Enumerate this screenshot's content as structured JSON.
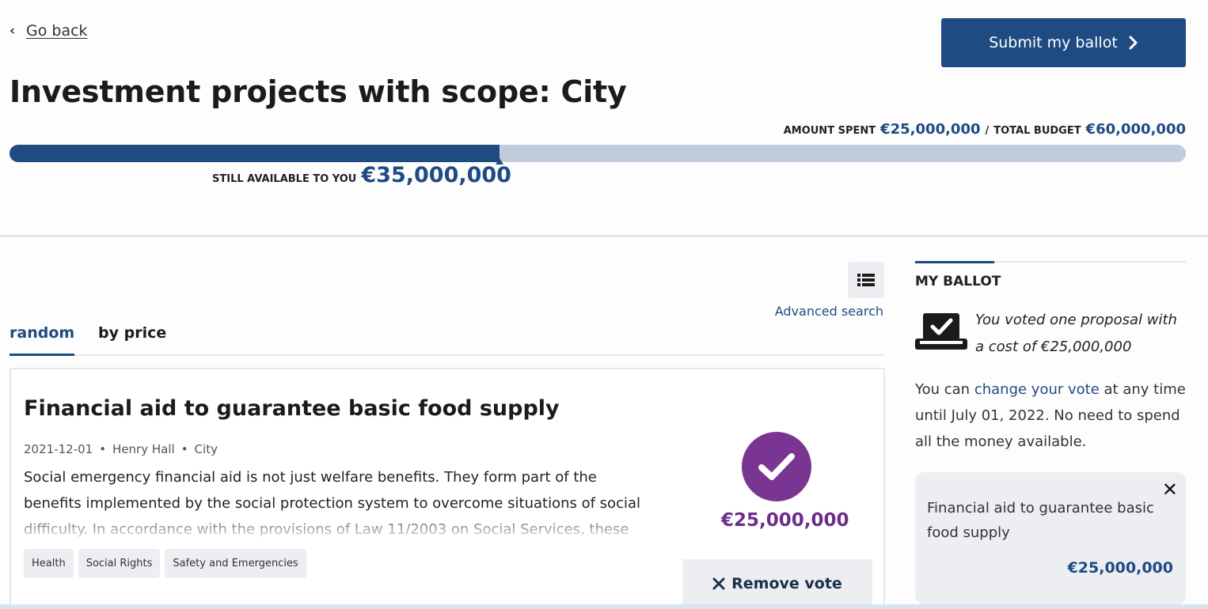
{
  "nav": {
    "back_label": "Go back"
  },
  "header": {
    "submit_label": "Submit my ballot",
    "title": "Investment projects with scope: City"
  },
  "budget": {
    "amount_spent_label": "AMOUNT SPENT",
    "amount_spent": "€25,000,000",
    "separator": "/",
    "total_budget_label": "TOTAL BUDGET",
    "total_budget": "€60,000,000",
    "still_available_label": "STILL AVAILABLE TO YOU",
    "still_available": "€35,000,000",
    "progress_fraction": 0.4167,
    "colors": {
      "accent": "#1e4b82",
      "track": "#c0ccdb"
    }
  },
  "toolbar": {
    "view_toggle_icon": "list-view-icon",
    "advanced_search_label": "Advanced search"
  },
  "tabs": [
    {
      "label": "random",
      "active": true
    },
    {
      "label": "by price",
      "active": false
    }
  ],
  "investment": {
    "title": "Financial aid to guarantee basic food supply",
    "date": "2021-12-01",
    "author": "Henry Hall",
    "scope": "City",
    "meta_separator": "•",
    "description": "Social emergency financial aid is not just welfare benefits. They form part of the benefits implemented by the social protection system to overcome situations of social difficulty. In accordance with the provisions of Law 11/2003 on Social Services, these",
    "tags": [
      "Health",
      "Social Rights",
      "Safety and Emergencies"
    ],
    "voted_icon": "check-circle-icon",
    "price": "€25,000,000",
    "remove_vote_label": "Remove vote",
    "colors": {
      "voted": "#7a3592"
    }
  },
  "ballot": {
    "heading": "MY BALLOT",
    "icon": "ballot-box-icon",
    "voted_summary": "You voted one proposal with a cost of €25,000,000",
    "change_prefix": "You can",
    "change_link": "change your vote",
    "change_suffix": "at any time until July 01, 2022. No need to spend all the money available.",
    "items": [
      {
        "title": "Financial aid to guarantee basic food supply",
        "price": "€25,000,000",
        "remove_icon": "close-icon"
      }
    ]
  }
}
